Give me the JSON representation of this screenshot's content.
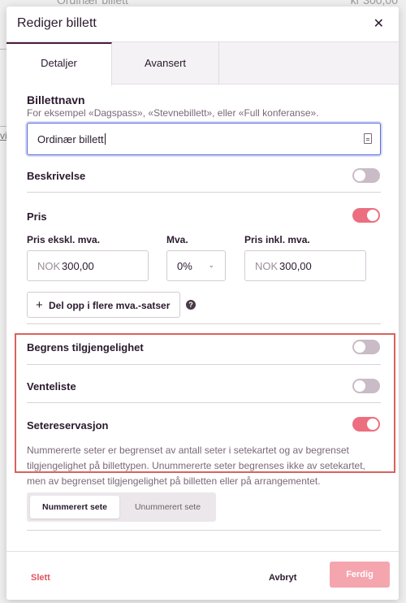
{
  "background": {
    "row_title": "Ordinær billett",
    "row_price": "kr 300,00",
    "side_link": "vi"
  },
  "modal": {
    "title": "Rediger billett",
    "close_icon": "✕"
  },
  "tabs": [
    {
      "label": "Detaljer",
      "active": true
    },
    {
      "label": "Avansert",
      "active": false
    }
  ],
  "ticket_name": {
    "label": "Billettnavn",
    "hint": "For eksempel «Dagspass», «Stevnebillett», eller «Full konferanse».",
    "value": "Ordinær billett"
  },
  "description": {
    "label": "Beskrivelse",
    "enabled": false
  },
  "price": {
    "label": "Pris",
    "enabled": true,
    "excl_label": "Pris ekskl. mva.",
    "vat_label": "Mva.",
    "incl_label": "Pris inkl. mva.",
    "currency": "NOK",
    "excl_value": "300,00",
    "vat_value": "0%",
    "incl_value": "300,00",
    "split_button": "Del opp i flere mva.-satser"
  },
  "limit_availability": {
    "label": "Begrens tilgjengelighet",
    "enabled": false
  },
  "waitlist": {
    "label": "Venteliste",
    "enabled": false
  },
  "seat_reservation": {
    "label": "Setereservasjon",
    "enabled": true,
    "description": "Nummererte seter er begrenset av antall seter i setekartet og av begrenset tilgjengelighet på billettypen. Unummererte seter begrenses ikke av setekartet, men av begrenset tilgjengelighet på billetten eller på arrangementet.",
    "options": [
      {
        "label": "Nummerert sete",
        "selected": true
      },
      {
        "label": "Unummerert sete",
        "selected": false
      }
    ]
  },
  "footer": {
    "delete": "Slett",
    "cancel": "Avbryt",
    "done": "Ferdig"
  },
  "colors": {
    "accent": "#ec6f7f",
    "highlight_border": "#d9625d",
    "done_button": "#f4a5ae",
    "text": "#2a1a2e"
  }
}
